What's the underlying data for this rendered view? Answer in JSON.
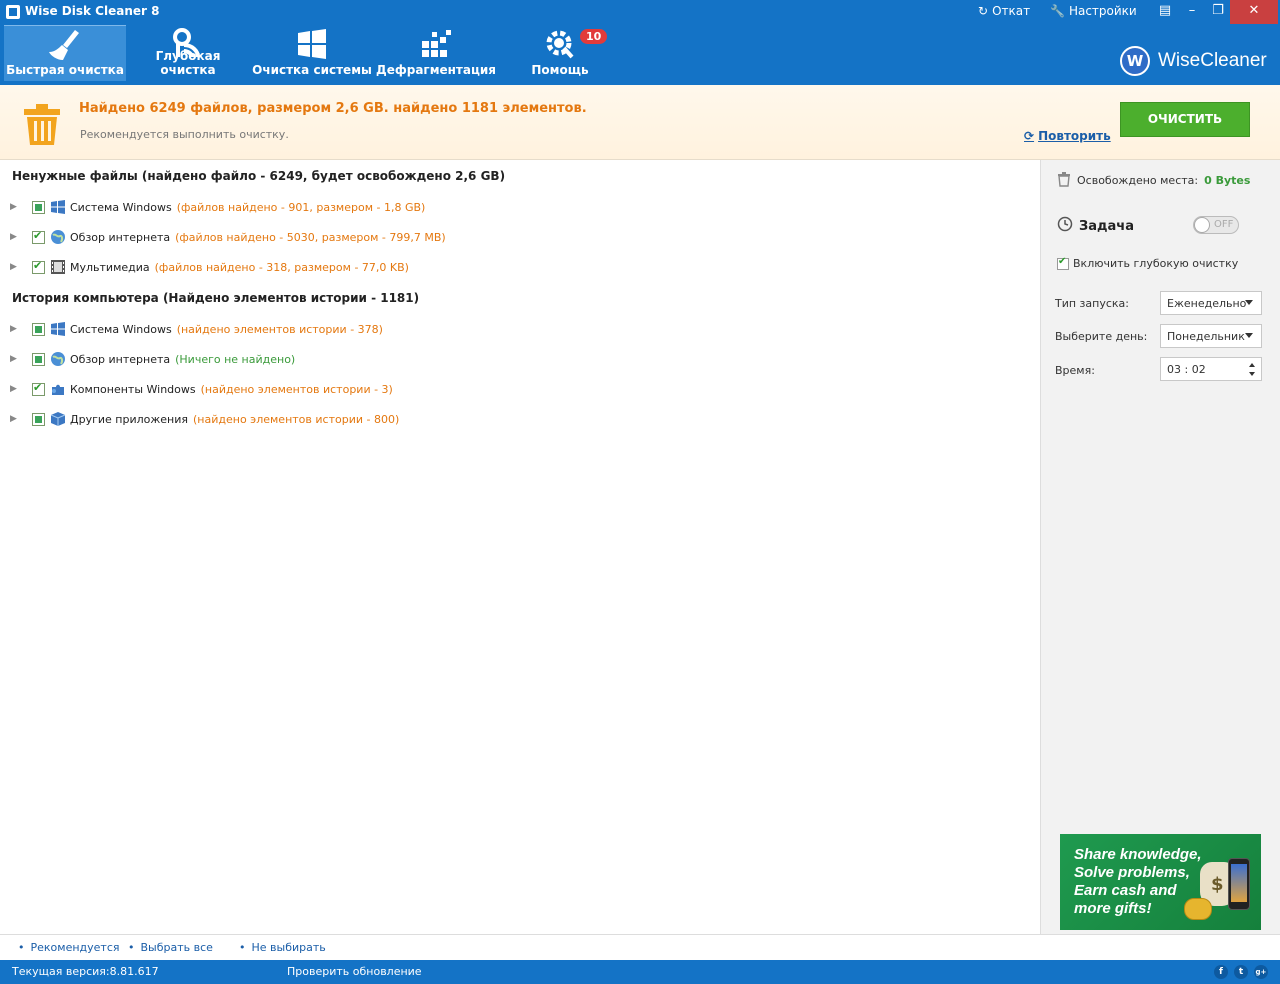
{
  "window": {
    "title": "Wise Disk Cleaner 8",
    "links": {
      "undo": "Откат",
      "settings": "Настройки"
    }
  },
  "toolbar": {
    "tabs": [
      {
        "label": "Быстрая очистка",
        "icon": "broom-icon",
        "active": true
      },
      {
        "label": "Глубокая очистка",
        "icon": "deep-clean-icon",
        "active": false
      },
      {
        "label": "Очистка системы",
        "icon": "windows-icon",
        "active": false
      },
      {
        "label": "Дефрагментация",
        "icon": "defrag-icon",
        "active": false
      },
      {
        "label": "Помощь",
        "icon": "gear-icon",
        "active": false
      }
    ],
    "help_badge": "10"
  },
  "brand": {
    "logo_letter": "W",
    "name": "WiseCleaner"
  },
  "summary": {
    "title": "Найдено 6249 файлов, размером 2,6 GB. найдено 1181 элементов.",
    "subtitle": "Рекомендуется выполнить очистку.",
    "repeat_label": "Повторить",
    "clean_button": "ОЧИСТИТЬ"
  },
  "sections": [
    {
      "title": "Ненужные файлы (найдено файло - 6249, будет освобождено 2,6 GB)",
      "rows": [
        {
          "name": "Система Windows",
          "detail": "(файлов найдено - 901, размером -  1,8 GB)",
          "check": "partial",
          "icon": "windows-icon"
        },
        {
          "name": "Обзор интернета",
          "detail": "(файлов найдено - 5030, размером -  799,7 MB)",
          "check": "full",
          "icon": "globe-icon"
        },
        {
          "name": "Мультимедиа",
          "detail": "(файлов найдено - 318, размером -  77,0 KB)",
          "check": "full",
          "icon": "film-icon"
        }
      ]
    },
    {
      "title": "История компьютера (Найдено элементов истории - 1181)",
      "rows": [
        {
          "name": "Система Windows",
          "detail": "(найдено элементов истории - 378)",
          "check": "partial",
          "icon": "windows-icon"
        },
        {
          "name": "Обзор интернета",
          "detail": "(Ничего не найдено)",
          "check": "partial",
          "icon": "globe-icon",
          "green": true
        },
        {
          "name": "Компоненты Windows",
          "detail": "(найдено элементов истории - 3)",
          "check": "full",
          "icon": "puzzle-icon"
        },
        {
          "name": "Другие приложения",
          "detail": "(найдено элементов истории - 800)",
          "check": "partial",
          "icon": "box-icon"
        }
      ]
    }
  ],
  "side": {
    "freed_label": "Освобождено места:",
    "freed_value": "0 Bytes",
    "task_label": "Задача",
    "toggle_text": "OFF",
    "deep_label": "Включить глубокую очистку",
    "launch_label": "Тип запуска:",
    "launch_value": "Еженедельно",
    "day_label": "Выберите день:",
    "day_value": "Понедельник",
    "time_label": "Время:",
    "time_value": "03 : 02",
    "promo_lines": [
      "Share knowledge,",
      "Solve problems,",
      "Earn cash and",
      "more gifts!"
    ]
  },
  "bottom": {
    "recommended": "Рекомендуется",
    "select_all": "Выбрать все",
    "select_none": "Не выбирать"
  },
  "status": {
    "version": "Текущая версия:8.81.617",
    "check_update": "Проверить обновление",
    "social": [
      "f",
      "t",
      "g+"
    ]
  }
}
